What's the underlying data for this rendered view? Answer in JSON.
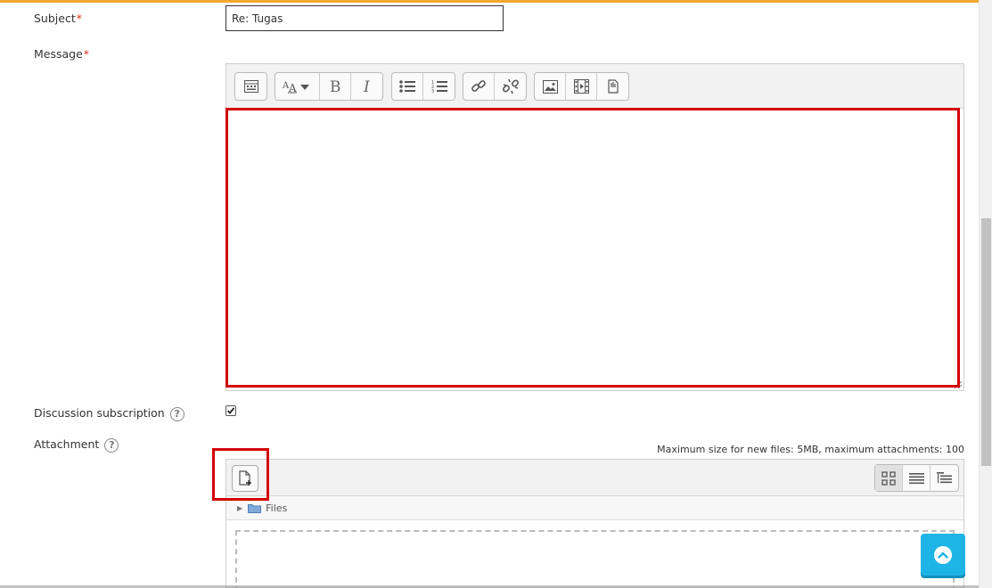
{
  "form": {
    "subject": {
      "label": "Subject",
      "required_mark": "*",
      "value": "Re: Tugas"
    },
    "message": {
      "label": "Message",
      "required_mark": "*",
      "value": ""
    },
    "subscription": {
      "label": "Discussion subscription",
      "help": "?",
      "checked": true
    },
    "attachment": {
      "label": "Attachment",
      "help": "?",
      "max_info": "Maximum size for new files: 5MB, maximum attachments: 100"
    }
  },
  "editor_toolbar": {
    "groups": [
      [
        "toggle-toolbar-icon"
      ],
      [
        "font-size-icon",
        "bold-icon",
        "italic-icon"
      ],
      [
        "unordered-list-icon",
        "ordered-list-icon"
      ],
      [
        "link-icon",
        "unlink-icon"
      ],
      [
        "image-icon",
        "media-icon",
        "manage-files-icon"
      ]
    ]
  },
  "filepicker": {
    "path_root": "Files",
    "views": [
      "icons-view-icon",
      "list-view-icon",
      "tree-view-icon"
    ],
    "active_view": "icons-view-icon"
  },
  "colors": {
    "accent_top": "#f3a830",
    "highlight": "#d40000",
    "scroll_top_button": "#1fb4e6"
  }
}
